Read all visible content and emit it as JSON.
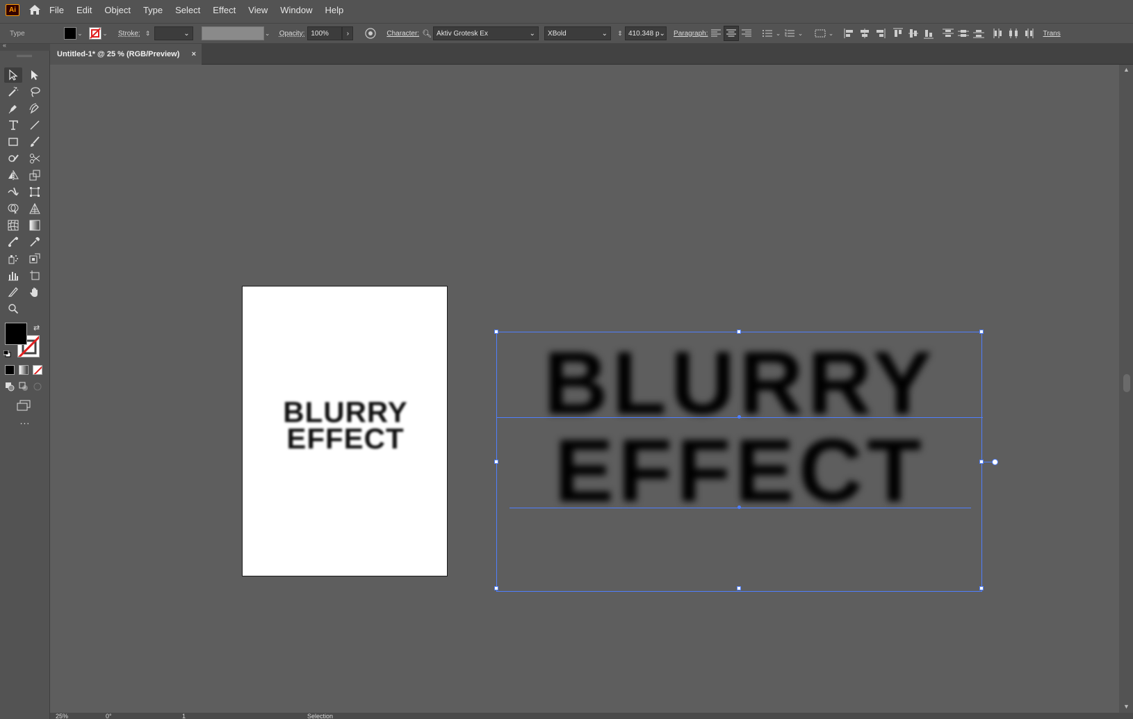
{
  "app": {
    "logo": "Ai",
    "home_icon": "home-icon"
  },
  "menu": [
    "File",
    "Edit",
    "Object",
    "Type",
    "Select",
    "Effect",
    "View",
    "Window",
    "Help"
  ],
  "control": {
    "tool_name": "Type",
    "stroke_label": "Stroke:",
    "opacity_label": "Opacity:",
    "opacity_value": "100%",
    "character_label": "Character:",
    "font_family": "Aktiv Grotesk Ex",
    "font_style": "XBold",
    "font_size": "410.348 p",
    "paragraph_label": "Paragraph:",
    "transform_label": "Trans"
  },
  "document": {
    "tab_title": "Untitled-1* @ 25 % (RGB/Preview)",
    "close": "×"
  },
  "artboard": {
    "line1": "BLURRY",
    "line2": "EFFECT"
  },
  "selected_text": {
    "line1": "BLURRY",
    "line2": "EFFECT"
  },
  "toolbar": {
    "more": "..."
  },
  "status": {
    "zoom": "25%",
    "rotate": "0°",
    "artboard_num": "1",
    "mode": "Selection"
  },
  "colors": {
    "fill": "#000000",
    "stroke": "none",
    "selection": "#4f7fff"
  }
}
